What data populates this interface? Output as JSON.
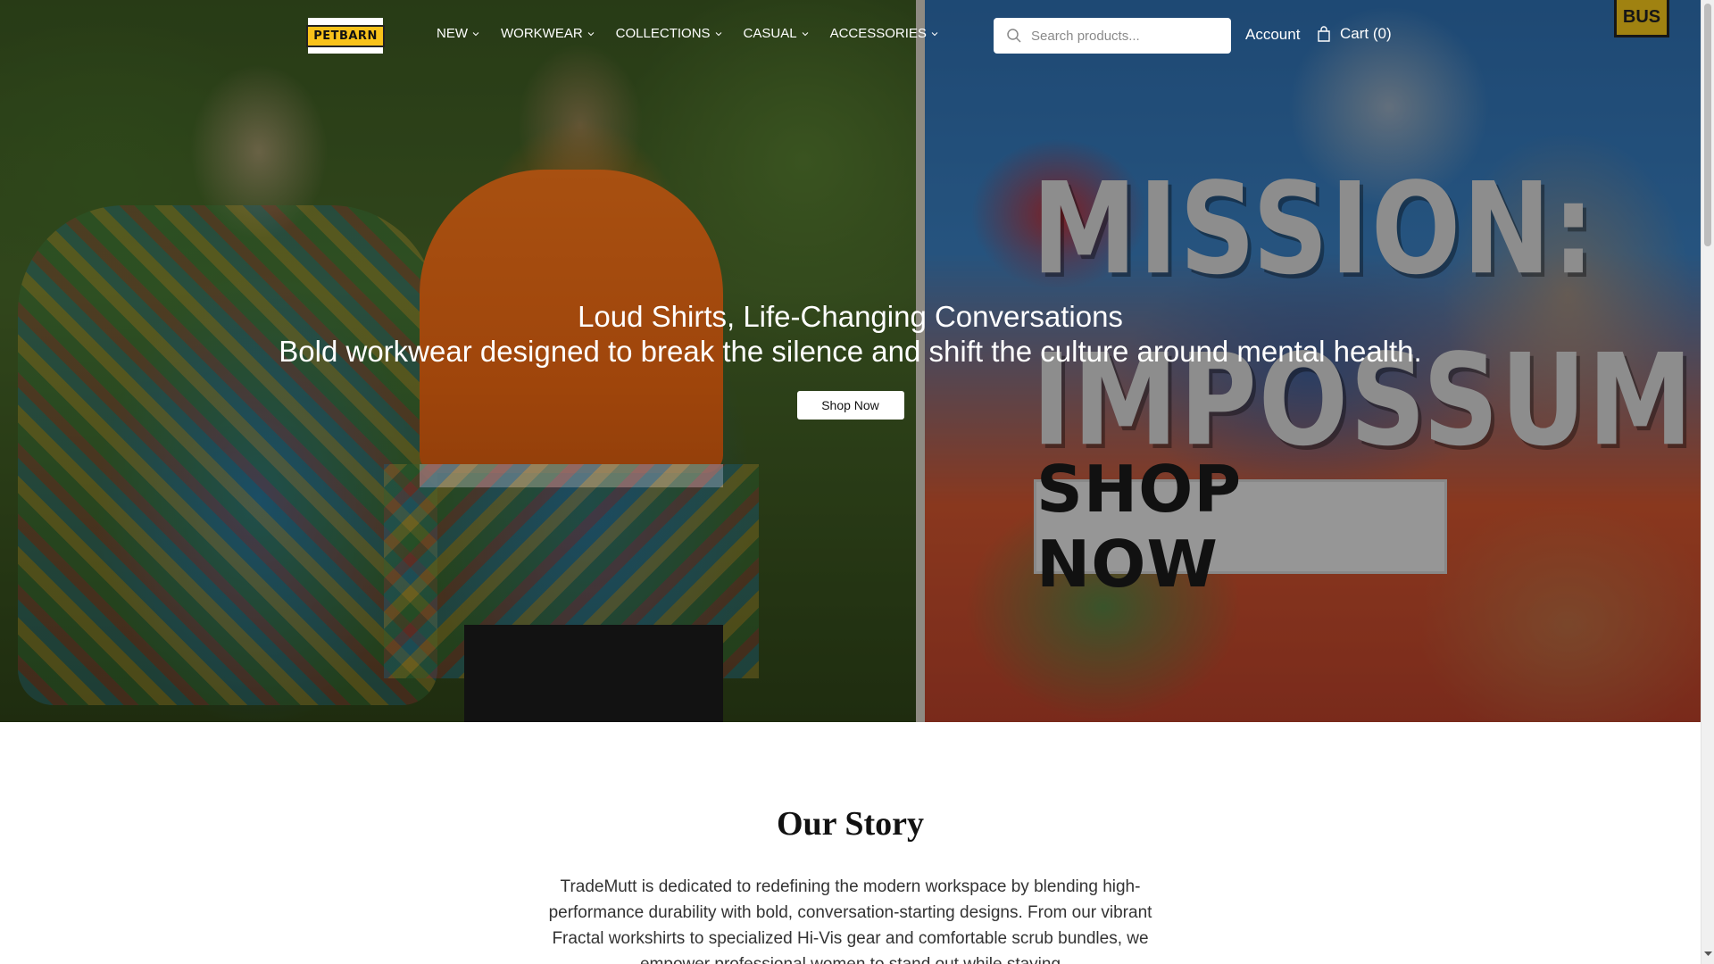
{
  "header": {
    "logo_text": "PETBARN",
    "nav": [
      {
        "label": "NEW"
      },
      {
        "label": "WORKWEAR"
      },
      {
        "label": "COLLECTIONS"
      },
      {
        "label": "CASUAL"
      },
      {
        "label": "ACCESSORIES"
      }
    ],
    "search": {
      "placeholder": "Search products...",
      "value": ""
    },
    "account_label": "Account",
    "cart_label": "Cart (0)"
  },
  "hero": {
    "title": "Loud Shirts, Life-Changing Conversations",
    "subtitle": "Bold workwear designed to break the silence and shift the culture around mental health.",
    "cta_label": "Shop Now",
    "poster": {
      "line1": "MISSION:",
      "line2": "IMPOSSUMBLE",
      "cta": "SHOP NOW",
      "sign": "BUS"
    }
  },
  "story": {
    "title": "Our Story",
    "text": "TradeMutt is dedicated to redefining the modern workspace by blending high-performance durability with bold, conversation-starting designs. From our vibrant Fractal workshirts to specialized Hi-Vis gear and comfortable scrub bundles, we empower professional women to stand out while staying"
  },
  "icons": {
    "search": "search-icon",
    "cart": "shopping-bag-icon",
    "dropdown": "chevron-down-icon"
  }
}
